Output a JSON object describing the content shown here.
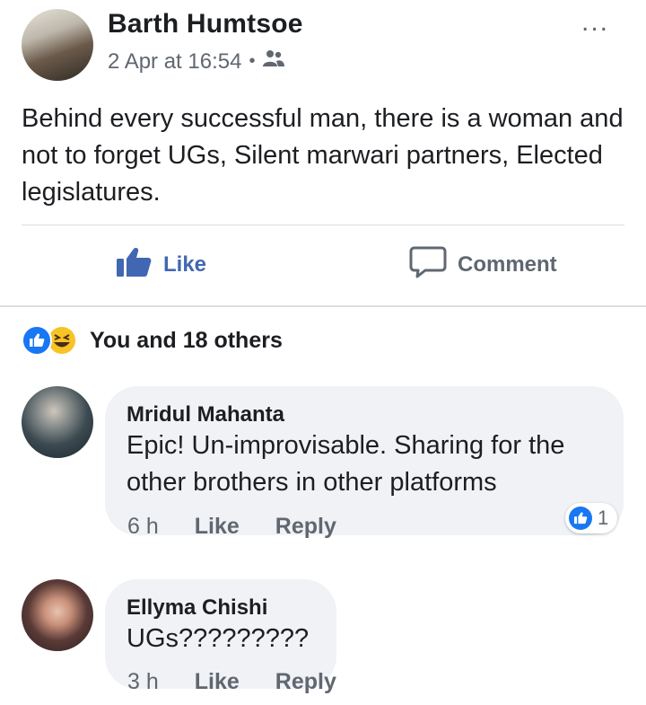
{
  "post": {
    "author": "Barth Humtsoe",
    "timestamp": "2 Apr at 16:54",
    "separator": "•",
    "audience_icon": "friends-icon",
    "more_icon": "more-options-icon",
    "more_label": "...",
    "text": "Behind every successful man, there is a woman and not to forget UGs, Silent marwari partners, Elected legislatures."
  },
  "actions": {
    "like_label": "Like",
    "comment_label": "Comment"
  },
  "reactions": {
    "summary": "You and 18 others",
    "icons": [
      "like-reaction-icon",
      "haha-reaction-icon"
    ]
  },
  "comments": [
    {
      "author": "Mridul Mahanta",
      "text": "Epic! Un-improvisable. Sharing for the other brothers in other platforms",
      "time": "6 h",
      "like_label": "Like",
      "reply_label": "Reply",
      "reaction_count": "1"
    },
    {
      "author": "Ellyma Chishi",
      "text": "UGs?????????",
      "time": "3 h",
      "like_label": "Like",
      "reply_label": "Reply"
    }
  ],
  "colors": {
    "brand_blue": "#4267b2",
    "text_primary": "#1c1e21",
    "text_secondary": "#606770",
    "bubble_bg": "#f0f2f5"
  }
}
